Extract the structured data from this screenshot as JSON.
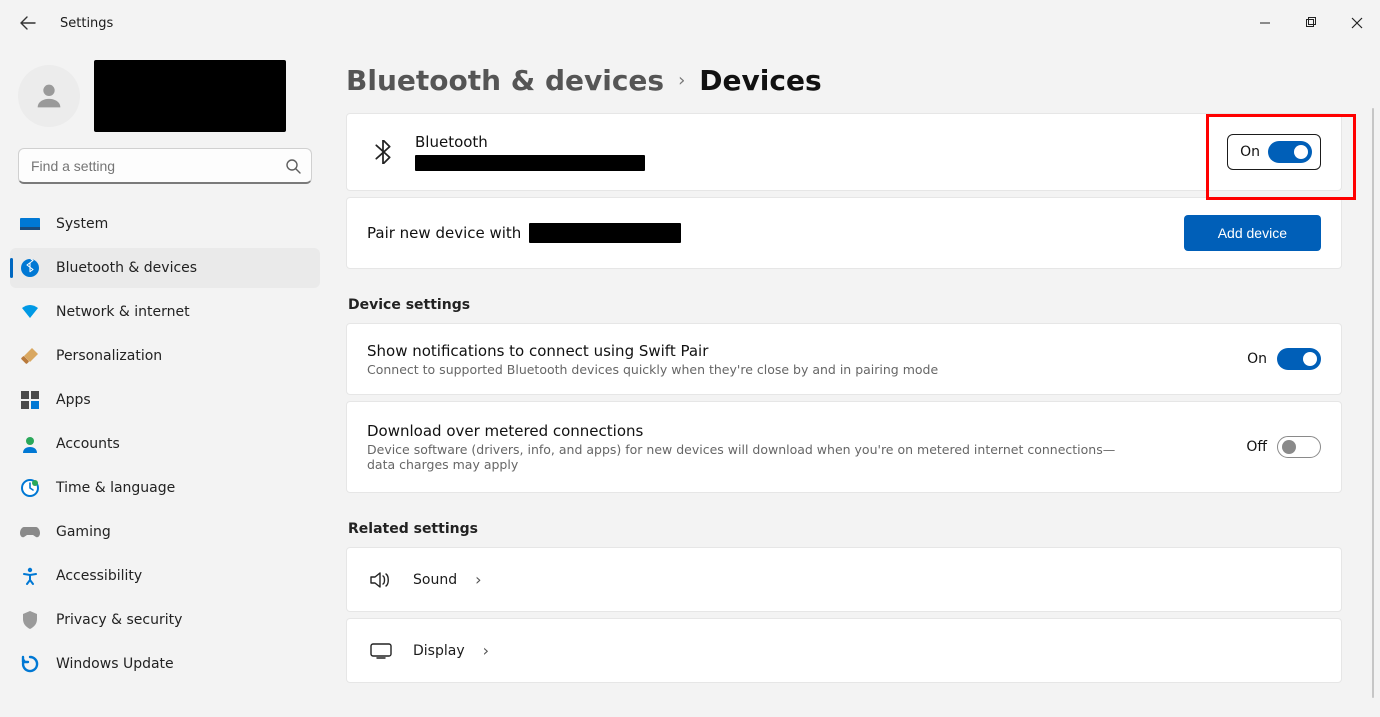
{
  "titlebar": {
    "title": "Settings"
  },
  "search": {
    "placeholder": "Find a setting"
  },
  "sidebar": {
    "items": [
      {
        "key": "system",
        "label": "System"
      },
      {
        "key": "bluetooth",
        "label": "Bluetooth & devices",
        "active": true
      },
      {
        "key": "network",
        "label": "Network & internet"
      },
      {
        "key": "personalization",
        "label": "Personalization"
      },
      {
        "key": "apps",
        "label": "Apps"
      },
      {
        "key": "accounts",
        "label": "Accounts"
      },
      {
        "key": "time",
        "label": "Time & language"
      },
      {
        "key": "gaming",
        "label": "Gaming"
      },
      {
        "key": "accessibility",
        "label": "Accessibility"
      },
      {
        "key": "privacy",
        "label": "Privacy & security"
      },
      {
        "key": "update",
        "label": "Windows Update"
      }
    ]
  },
  "breadcrumb": {
    "parent": "Bluetooth & devices",
    "current": "Devices"
  },
  "bluetooth_row": {
    "label": "Bluetooth",
    "state": "On"
  },
  "pair_row": {
    "prefix": "Pair new device with",
    "button": "Add device"
  },
  "sections": {
    "device_settings": "Device settings",
    "related_settings": "Related settings"
  },
  "swift_pair": {
    "label": "Show notifications to connect using Swift Pair",
    "sub": "Connect to supported Bluetooth devices quickly when they're close by and in pairing mode",
    "state": "On"
  },
  "metered": {
    "label": "Download over metered connections",
    "sub": "Device software (drivers, info, and apps) for new devices will download when you're on metered internet connections—data charges may apply",
    "state": "Off"
  },
  "related": {
    "sound": "Sound",
    "display": "Display"
  }
}
